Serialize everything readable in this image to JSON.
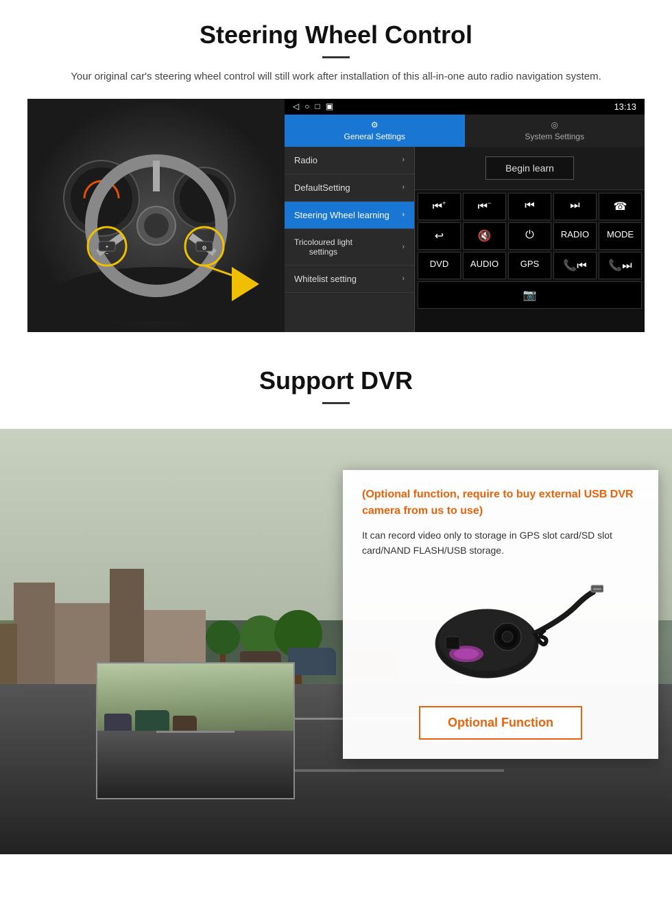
{
  "steering": {
    "title": "Steering Wheel Control",
    "description": "Your original car's steering wheel control will still work after installation of this all-in-one auto radio navigation system.",
    "statusbar": {
      "time": "13:13",
      "icons_left": [
        "◁",
        "○",
        "□",
        "▣"
      ],
      "signal": "▲▼"
    },
    "tabs": [
      {
        "label": "General Settings",
        "icon": "⚙",
        "active": true
      },
      {
        "label": "System Settings",
        "icon": "◎",
        "active": false
      }
    ],
    "menu_items": [
      {
        "label": "Radio",
        "active": false
      },
      {
        "label": "DefaultSetting",
        "active": false
      },
      {
        "label": "Steering Wheel learning",
        "active": true
      },
      {
        "label": "Tricoloured light settings",
        "active": false
      },
      {
        "label": "Whitelist setting",
        "active": false
      }
    ],
    "begin_learn": "Begin learn",
    "controls": [
      [
        "⏮+",
        "⏮−",
        "⏮",
        "⏭",
        "☎"
      ],
      [
        "↩",
        "🔇",
        "⏻",
        "RADIO",
        "MODE"
      ],
      [
        "DVD",
        "AUDIO",
        "GPS",
        "📞⏮",
        "📞⏭"
      ],
      [
        "📷"
      ]
    ]
  },
  "dvr": {
    "title": "Support DVR",
    "optional_text": "(Optional function, require to buy external USB DVR camera from us to use)",
    "description": "It can record video only to storage in GPS slot card/SD slot card/NAND FLASH/USB storage.",
    "optional_button": "Optional Function"
  }
}
